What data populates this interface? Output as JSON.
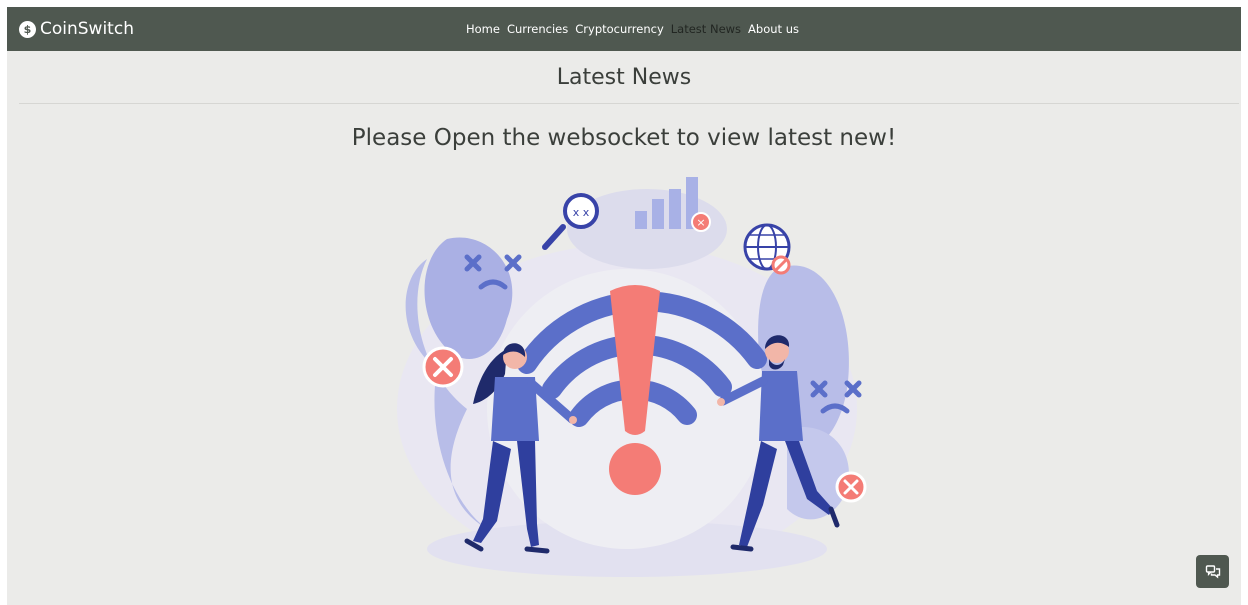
{
  "brand": {
    "name": "CoinSwitch",
    "logo_glyph": "$"
  },
  "nav": {
    "items": [
      {
        "label": "Home",
        "active": false
      },
      {
        "label": "Currencies",
        "active": false
      },
      {
        "label": "Cryptocurrency",
        "active": false
      },
      {
        "label": "Latest News",
        "active": true
      },
      {
        "label": "About us",
        "active": false
      }
    ]
  },
  "main": {
    "title": "Latest News",
    "message": "Please Open the websocket to view latest new!",
    "illustration_icons": [
      "wifi-warning-icon",
      "magnifier-sad-icon",
      "bar-chart-error-icon",
      "globe-blocked-icon",
      "error-x-icon"
    ]
  },
  "chat": {
    "icon": "chat-bubbles-icon"
  },
  "colors": {
    "navbar": "#4f5850",
    "page_background": "#ebebe9",
    "text": "#3b3f3b",
    "wifi_blue": "#5b6fc9",
    "alert_red": "#f47c76"
  }
}
